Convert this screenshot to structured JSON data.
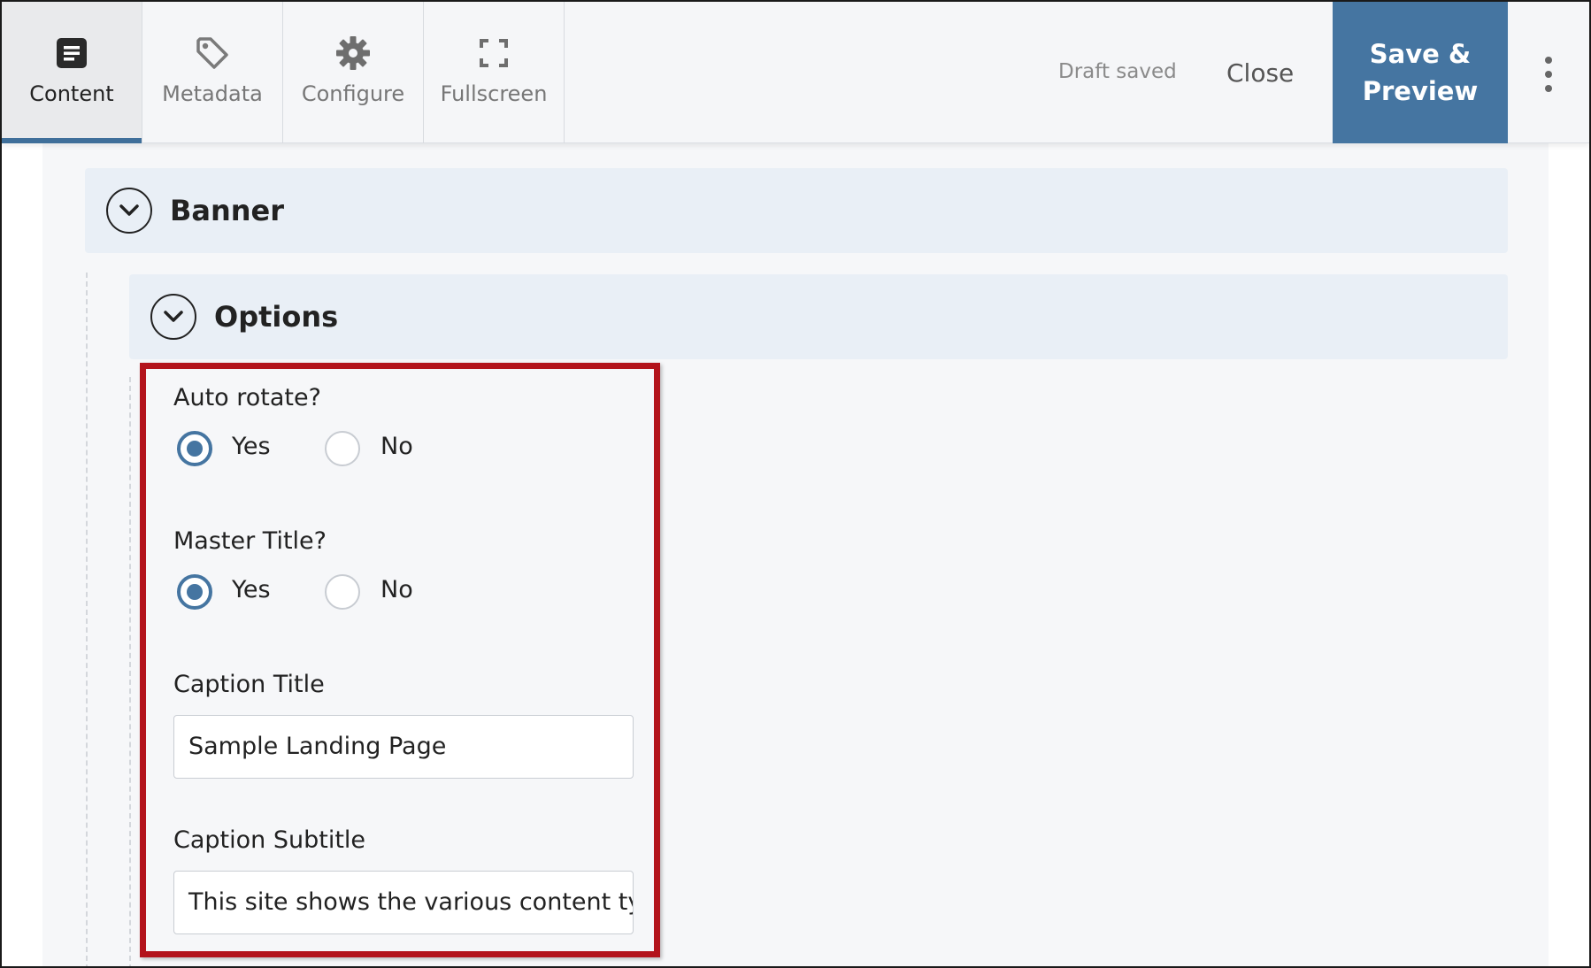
{
  "toolbar": {
    "tabs": [
      {
        "label": "Content",
        "icon": "document-icon",
        "active": true
      },
      {
        "label": "Metadata",
        "icon": "tag-icon",
        "active": false
      },
      {
        "label": "Configure",
        "icon": "gear-icon",
        "active": false
      },
      {
        "label": "Fullscreen",
        "icon": "fullscreen-icon",
        "active": false
      }
    ],
    "status": "Draft saved",
    "close_label": "Close",
    "save_label_line1": "Save &",
    "save_label_line2": "Preview",
    "more_icon": "kebab-menu-icon",
    "accent_color": "#4575a1"
  },
  "sections": {
    "banner_title": "Banner",
    "options_title": "Options"
  },
  "fields": {
    "auto_rotate": {
      "label": "Auto rotate?",
      "yes": "Yes",
      "no": "No",
      "selected": "Yes"
    },
    "master_title": {
      "label": "Master Title?",
      "yes": "Yes",
      "no": "No",
      "selected": "Yes"
    },
    "caption_title": {
      "label": "Caption Title",
      "value": "Sample Landing Page"
    },
    "caption_subtitle": {
      "label": "Caption Subtitle",
      "value": "This site shows the various content ty"
    }
  },
  "highlight_color": "#b3141c"
}
